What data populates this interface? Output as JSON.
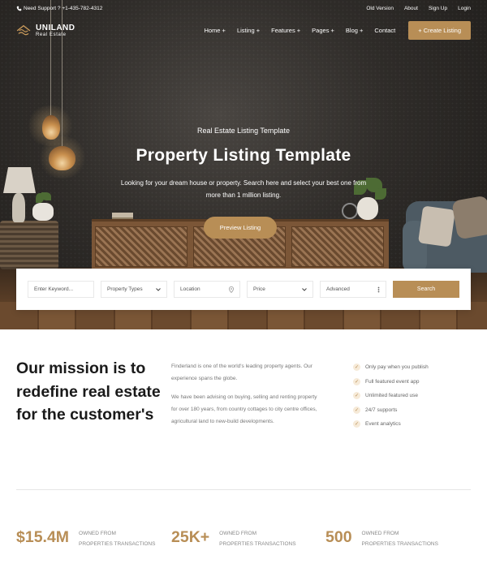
{
  "topbar": {
    "support_text": "Need Support ? +1-435-782-4312",
    "links": [
      "Old Version",
      "About",
      "Sign Up",
      "Login"
    ]
  },
  "brand": {
    "name": "UNILAND",
    "tagline": "Real Estate"
  },
  "nav": {
    "items": [
      "Home +",
      "Listing +",
      "Features +",
      "Pages +",
      "Blog +",
      "Contact"
    ],
    "cta": "+ Create Listing"
  },
  "hero": {
    "subtitle": "Real Estate Listing Template",
    "title": "Property Listing Template",
    "description": "Looking for your dream house or property. Search here and select your best one from more than 1 million listing.",
    "button": "Preview Listing"
  },
  "search": {
    "keyword_placeholder": "Enter Keyword...",
    "property_types": "Property Types",
    "location_placeholder": "Location",
    "price": "Price",
    "advanced": "Advanced",
    "button": "Search"
  },
  "mission": {
    "heading": "Our mission is to redefine real estate for the customer's",
    "paragraph1": "Finderland is one of the world's leading property agents. Our experience spans the globe.",
    "paragraph2": "We have been advising on buying, selling and renting property for over 180 years, from country cottages to city centre offices, agricultural land to new-build developments.",
    "features": [
      "Only pay when you publish",
      "Full featured event app",
      "Unlimited featured use",
      "24/7 supports",
      "Event analytics"
    ]
  },
  "stats": [
    {
      "value": "$15.4M",
      "label1": "OWNED FROM",
      "label2": "PROPERTIES TRANSACTIONS"
    },
    {
      "value": "25K+",
      "label1": "OWNED FROM",
      "label2": "PROPERTIES TRANSACTIONS"
    },
    {
      "value": "500",
      "label1": "OWNED FROM",
      "label2": "PROPERTIES TRANSACTIONS"
    }
  ],
  "colors": {
    "accent": "#b88e56",
    "dark": "#1a1a1a"
  }
}
